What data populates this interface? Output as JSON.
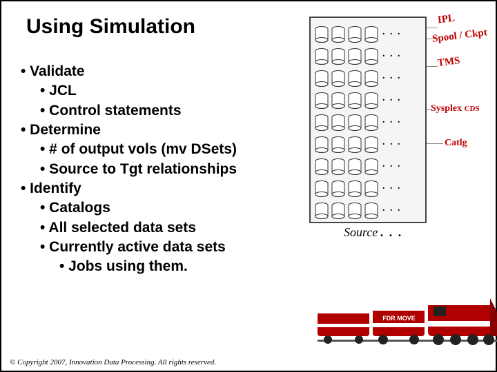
{
  "title": "Using Simulation",
  "bullets": {
    "b0": "• Validate",
    "b0a": "• JCL",
    "b0b": "• Control statements",
    "b1": "• Determine",
    "b1a": "• # of output vols (mv DSets)",
    "b1b": "• Source to Tgt relationships",
    "b2": "• Identify",
    "b2a": "• Catalogs",
    "b2b": "• All selected data sets",
    "b2c": "• Currently active data sets",
    "b2d": "• Jobs using them."
  },
  "diagram": {
    "row_dots": ". . .",
    "source_label": "Source",
    "source_dots": ". . ."
  },
  "annotations": {
    "ipl": "IPL",
    "spool": "Spool / Ckpt",
    "tms": "TMS",
    "sysplex": "Sysplex ",
    "sysplex_cds": "CDS",
    "catlg": "Catlg"
  },
  "train_label": "FDR MOVE",
  "footer": "© Copyright 2007, Innovation Data Processing. All rights reserved."
}
